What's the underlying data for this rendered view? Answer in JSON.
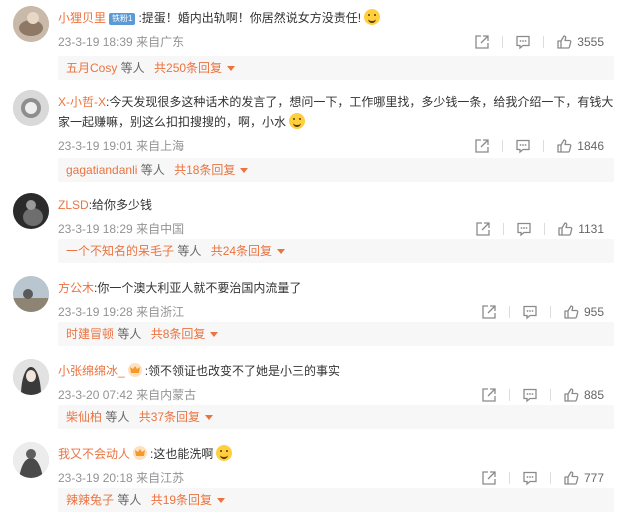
{
  "comments": [
    {
      "username": "小狸贝里",
      "badge": "铁粉1",
      "text": ":提蛋！婚内出轨啊！你居然说女方没责任!",
      "date": "23-3-19 18:39",
      "location": "来自广东",
      "likes": "3555",
      "reply": {
        "who": "五月Cosy",
        "etc": " 等人 ",
        "more": "共250条回复"
      }
    },
    {
      "username": "X-小哲-X",
      "text": ":今天发现很多这种话术的发言了，想问一下，工作哪里找，多少钱一条，给我介绍一下，有钱大家一起赚嘛，别这么扣扣搜搜的，啊，小水",
      "date": "23-3-19 19:01",
      "location": "来自上海",
      "likes": "1846",
      "reply": {
        "who": "gagatiandanli",
        "etc": " 等人 ",
        "more": "共18条回复"
      }
    },
    {
      "username": "ZLSD",
      "text": ":给你多少钱",
      "date": "23-3-19 18:29",
      "location": "来自中国",
      "likes": "1131",
      "reply": {
        "who": "一个不知名的呆毛子",
        "etc": " 等人 ",
        "more": "共24条回复"
      }
    },
    {
      "username": "方公木",
      "text": ":你一个澳大利亚人就不要治国内流量了",
      "date": "23-3-19 19:28",
      "location": "来自浙江",
      "likes": "955",
      "reply": {
        "who": "时建冒顿",
        "etc": " 等人 ",
        "more": "共8条回复"
      }
    },
    {
      "username": "小张绵绵冰_",
      "text": ":领不领证也改变不了她是小三的事实",
      "date": "23-3-20 07:42",
      "location": "来自内蒙古",
      "likes": "885",
      "reply": {
        "who": "柴仙柏",
        "etc": " 等人 ",
        "more": "共37条回复"
      }
    },
    {
      "username": "我又不会动人",
      "text": ":这也能洗啊",
      "date": "23-3-19 20:18",
      "location": "来自江苏",
      "likes": "777",
      "reply": {
        "who": "辣辣兔子",
        "etc": " 等人 ",
        "more": "共19条回复"
      }
    }
  ],
  "colors": {
    "username": "#eb7340",
    "meta": "#939393",
    "reply_bg": "#f7f7f7"
  }
}
